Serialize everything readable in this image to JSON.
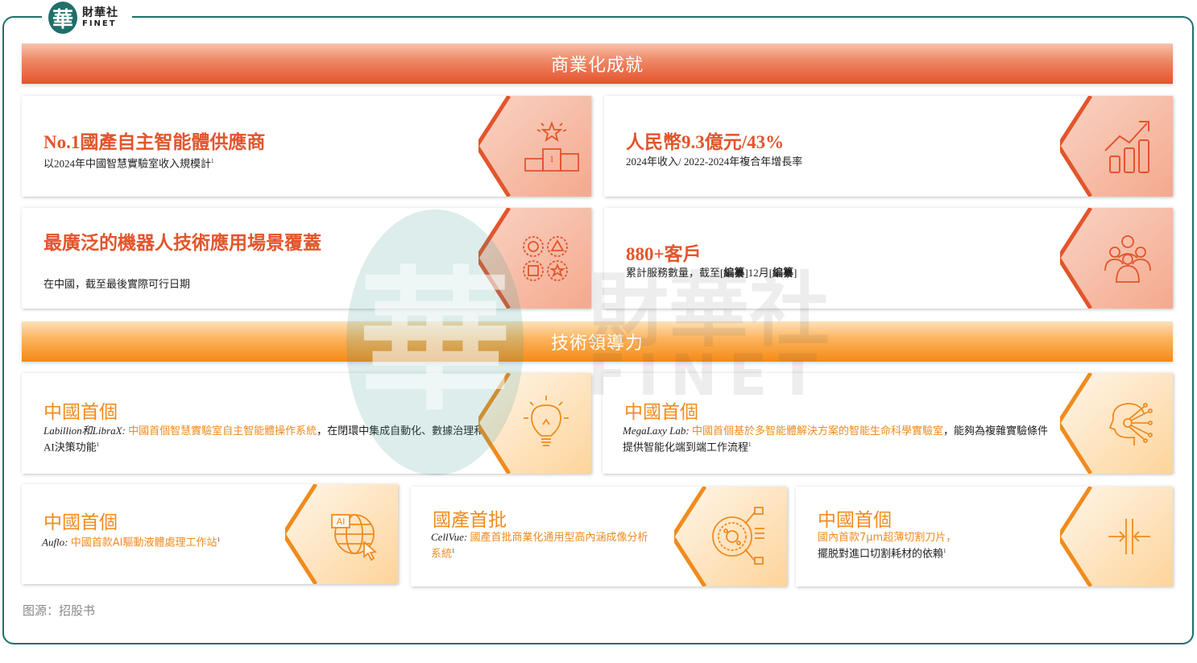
{
  "logo": {
    "mark": "華",
    "cn": "財華社",
    "en": "FINET"
  },
  "watermark": {
    "mark": "華",
    "cn": "財華社",
    "en": "FINET"
  },
  "sections": {
    "commercial": "商業化成就",
    "tech": "技術領導力"
  },
  "commercial_cards": [
    {
      "title": "No.1國產自主智能體供應商",
      "desc": "以2024年中國智慧實驗室收入規模計",
      "sup": "1",
      "icon": "podium-star-icon"
    },
    {
      "title": "人民幣9.3億元/43%",
      "desc": "2024年收入/ 2022-2024年複合年增長率",
      "icon": "growth-chart-icon"
    },
    {
      "title": "最廣泛的機器人技術應用場景覆蓋",
      "desc": "在中國，截至最後實際可行日期",
      "icon": "shapes-icon"
    },
    {
      "title": "880+客戶",
      "desc_pre": "累計服務數量，截至[",
      "desc_b1": "編纂",
      "desc_mid": "]12月[",
      "desc_b2": "編纂",
      "desc_post": "]",
      "icon": "people-icon"
    }
  ],
  "tech_cards": [
    {
      "title": "中國首個",
      "name": "Labillion和LibraX",
      "highlight": "中國首個智慧實驗室自主智能體操作系統",
      "rest": "，在閉環中集成自動化、數據治理和AI決策功能",
      "sup": "1",
      "icon": "lightbulb-icon"
    },
    {
      "title": "中國首個",
      "name": "MegaLaxy Lab",
      "highlight": "中國首個基於多智能體解決方案的智能生命科學實驗室",
      "rest": "，能夠為複雜實驗條件提供智能化端到端工作流程",
      "sup": "1",
      "icon": "ai-head-icon"
    },
    {
      "title": "中國首個",
      "name": "Auflo",
      "highlight": "中國首款AI驅動液體處理工作站",
      "rest": "",
      "sup": "1",
      "icon": "ai-globe-icon"
    },
    {
      "title": "國產首批",
      "name": "CellVue",
      "highlight": "國產首批商業化通用型高內涵成像分析系統",
      "rest": "",
      "sup": "1",
      "icon": "imaging-icon"
    },
    {
      "title": "中國首個",
      "name": "",
      "highlight": "國內首款7μm超薄切割刀片，",
      "rest": "擺脱對進口切割耗材的依賴",
      "sup": "1",
      "icon": "blade-icon"
    }
  ],
  "source": "图源：招股书",
  "colors": {
    "red": "#e2552c",
    "orange": "#f08b1e",
    "frame": "#1f6f6a"
  }
}
